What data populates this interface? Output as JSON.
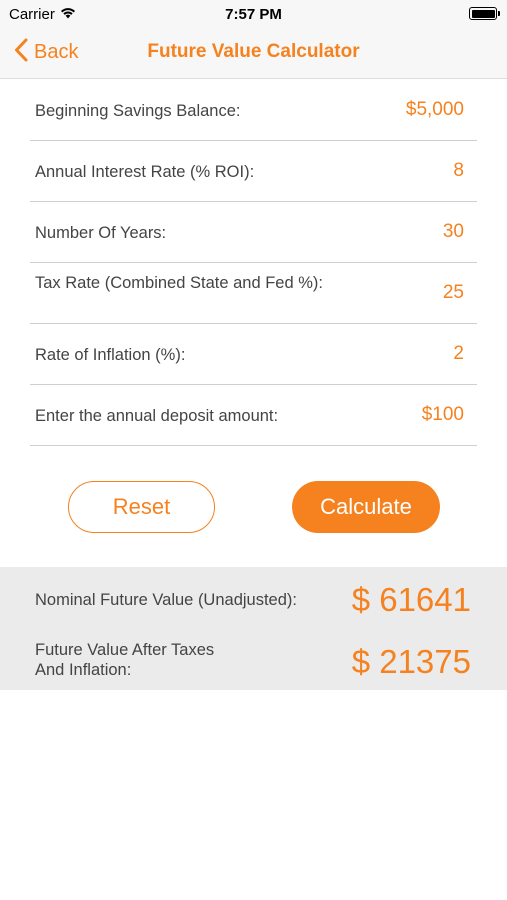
{
  "status_bar": {
    "carrier": "Carrier",
    "time": "7:57 PM"
  },
  "nav": {
    "back_label": "Back",
    "title": "Future Value Calculator"
  },
  "fields": [
    {
      "label": "Beginning Savings Balance:",
      "value": "$5,000"
    },
    {
      "label": "Annual Interest Rate (% ROI):",
      "value": "8"
    },
    {
      "label": "Number Of Years:",
      "value": "30"
    },
    {
      "label": "Tax Rate (Combined State and Fed %):",
      "value": "25"
    },
    {
      "label": "Rate of Inflation (%):",
      "value": "2"
    },
    {
      "label": "Enter the annual deposit amount:",
      "value": "$100"
    }
  ],
  "buttons": {
    "reset": "Reset",
    "calculate": "Calculate"
  },
  "results": [
    {
      "label": "Nominal Future Value (Unadjusted):",
      "value": "$ 61641"
    },
    {
      "label_line1": "Future Value After Taxes",
      "label_line2": "And Inflation:",
      "value": "$ 21375"
    }
  ],
  "colors": {
    "accent": "#f5821f",
    "result_bg": "#ebebeb",
    "nav_bg": "#f7f7f7"
  },
  "icons": {
    "back": "chevron-left-icon",
    "wifi": "wifi-icon",
    "battery": "battery-icon"
  }
}
